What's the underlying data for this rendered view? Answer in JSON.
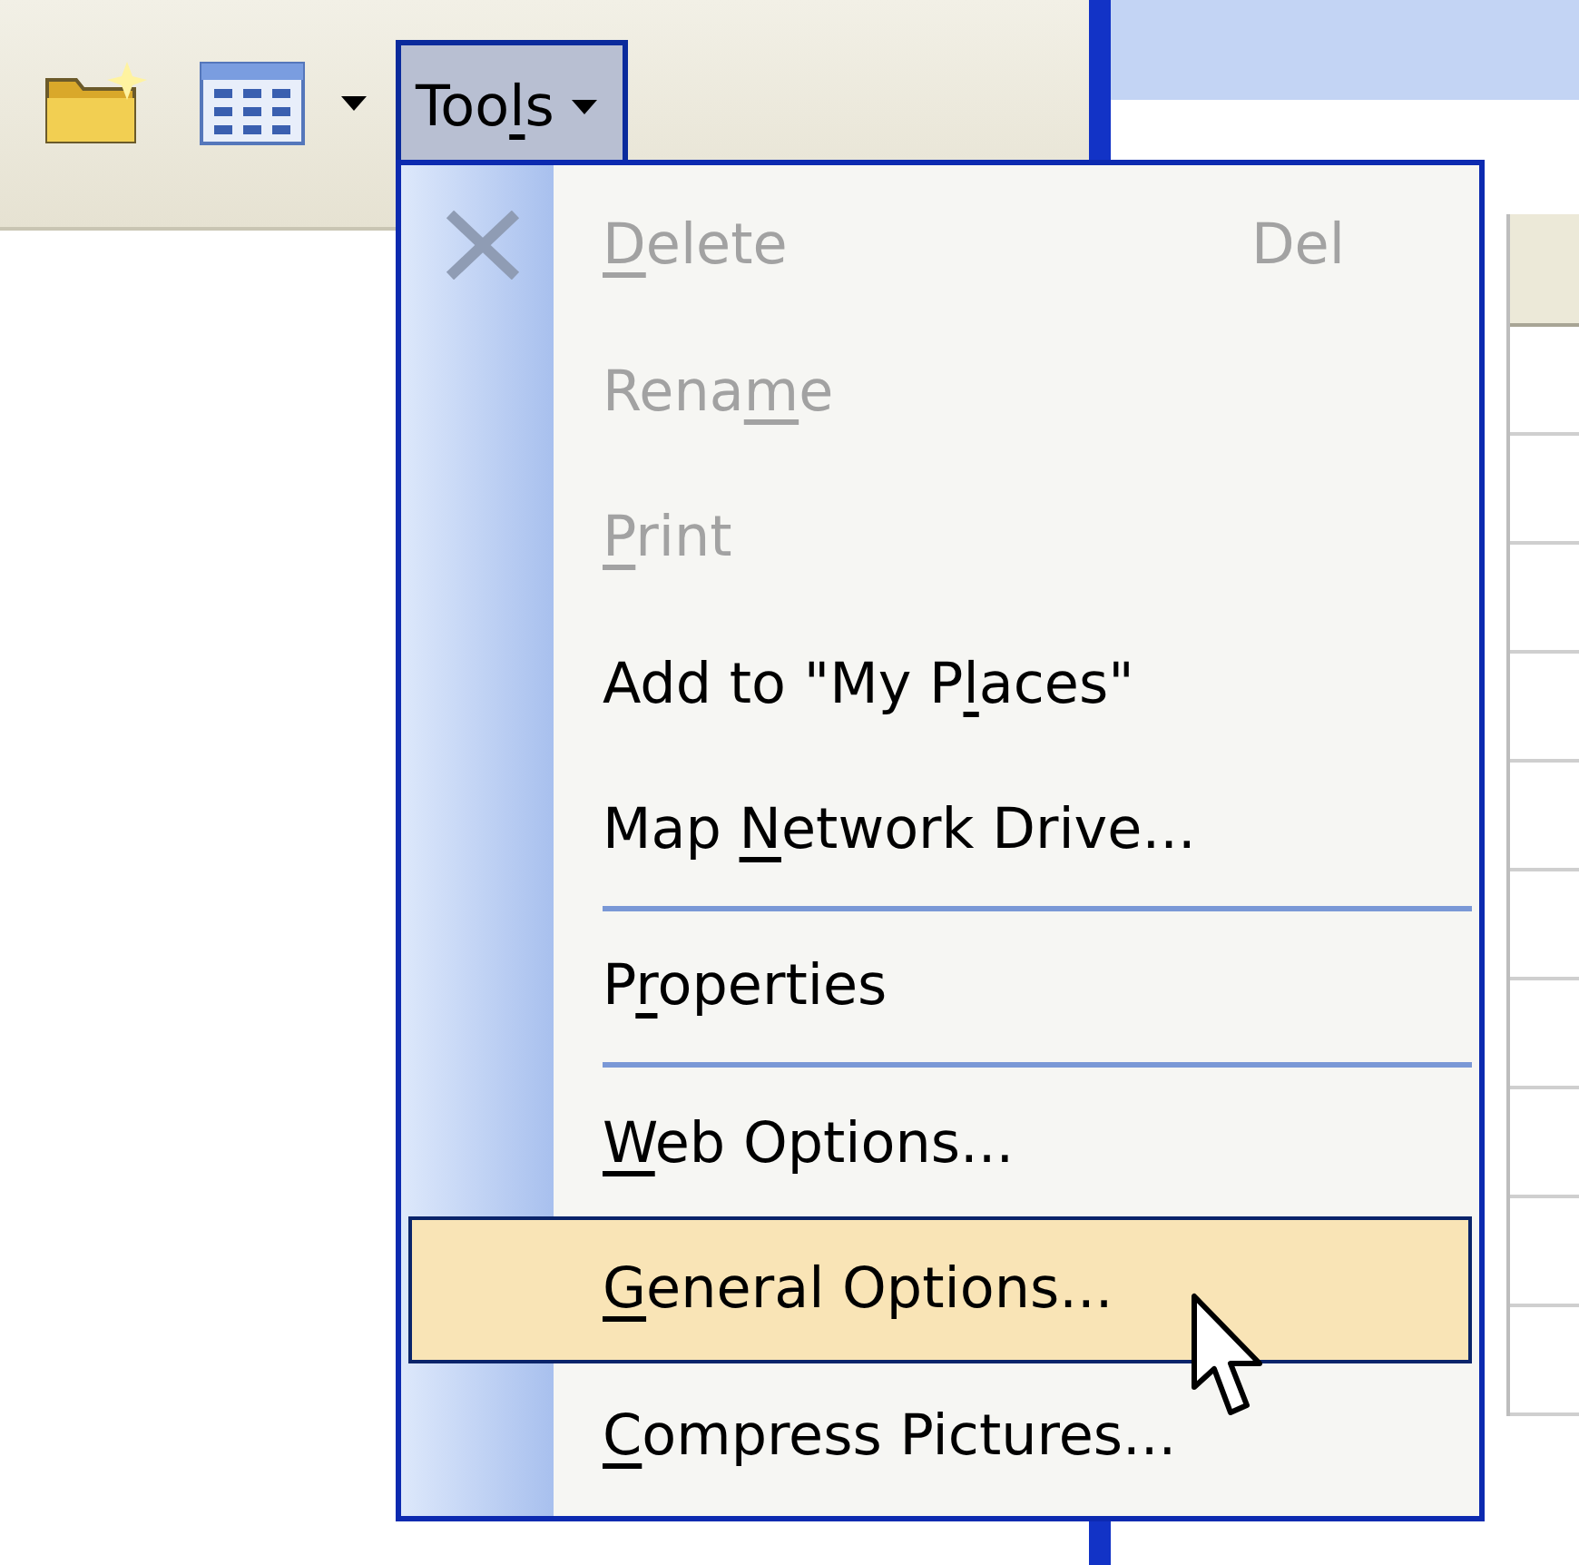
{
  "toolbar": {
    "tools_button": {
      "label": {
        "before": "Too",
        "key": "l",
        "after": "s"
      },
      "expanded": true
    }
  },
  "tools_menu": {
    "items": [
      {
        "kind": "item",
        "label": {
          "key": "D",
          "after": "elete"
        },
        "shortcut": "Del",
        "icon": true,
        "disabled": true,
        "selected": false
      },
      {
        "kind": "item",
        "label": {
          "before": "Rena",
          "key": "m",
          "after": "e"
        },
        "icon": false,
        "disabled": true,
        "selected": false
      },
      {
        "kind": "item",
        "label": {
          "key": "P",
          "after": "rint"
        },
        "icon": false,
        "disabled": true,
        "selected": false
      },
      {
        "kind": "item",
        "label": {
          "before": "Add to \"My P",
          "key": "l",
          "after": "aces\""
        },
        "icon": false,
        "disabled": false,
        "selected": false
      },
      {
        "kind": "item",
        "label": {
          "before": "Map ",
          "key": "N",
          "after": "etwork Drive..."
        },
        "icon": false,
        "disabled": false,
        "selected": false
      },
      {
        "kind": "separator"
      },
      {
        "kind": "item",
        "label": {
          "before": "P",
          "key": "r",
          "after": "operties"
        },
        "icon": false,
        "disabled": false,
        "selected": false
      },
      {
        "kind": "separator"
      },
      {
        "kind": "item",
        "label": {
          "key": "W",
          "after": "eb Options..."
        },
        "icon": false,
        "disabled": false,
        "selected": false
      },
      {
        "kind": "item",
        "label": {
          "key": "G",
          "after": "eneral Options..."
        },
        "icon": false,
        "disabled": false,
        "selected": true
      },
      {
        "kind": "item",
        "label": {
          "key": "C",
          "after": "ompress Pictures..."
        },
        "icon": false,
        "disabled": false,
        "selected": false
      }
    ]
  }
}
